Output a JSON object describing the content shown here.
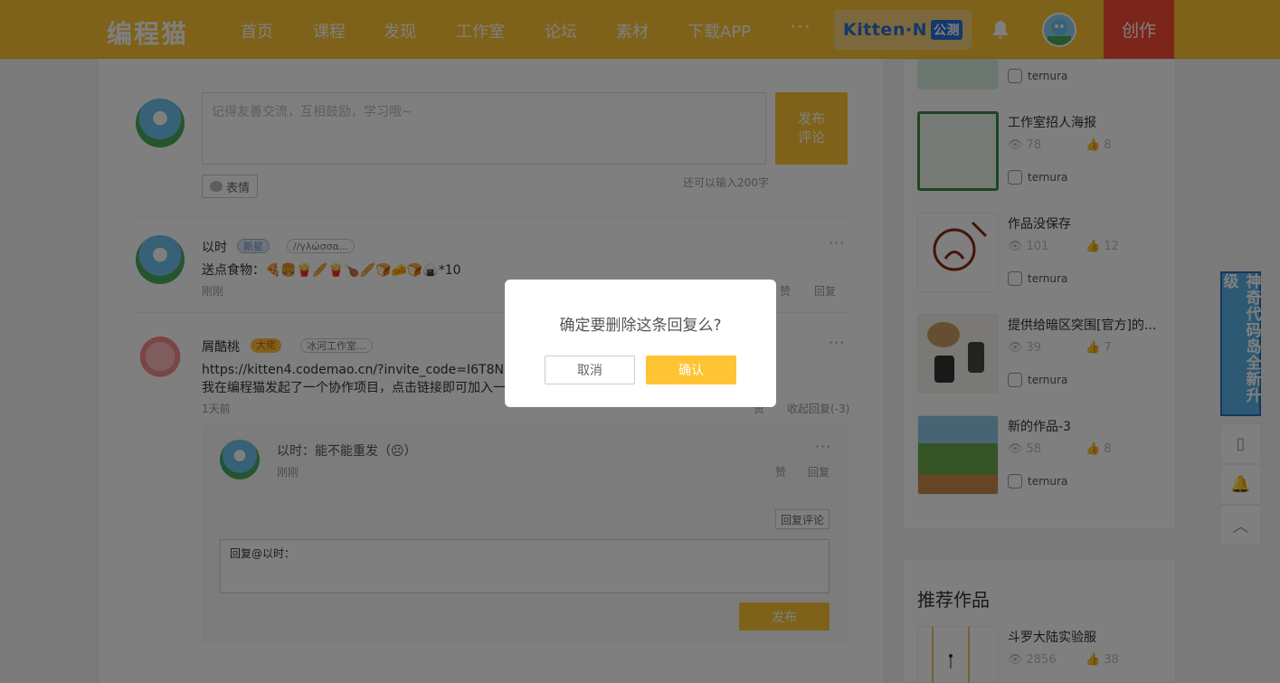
{
  "header": {
    "logo": "编程猫",
    "nav": [
      "首页",
      "课程",
      "发现",
      "工作室",
      "论坛",
      "素材",
      "下载APP"
    ],
    "more": "···",
    "kitten": "Kitten·N",
    "kitten_beta": "公测",
    "create": "创作"
  },
  "comment_form": {
    "placeholder": "记得友善交流，互相鼓励，学习哦~",
    "post_label_1": "发布",
    "post_label_2": "评论",
    "emoji_label": "表情",
    "char_left": "还可以输入200字"
  },
  "comments": [
    {
      "user": "以时",
      "tag1": "新星",
      "tag2": "//γλώσσα...",
      "text": "送点食物：🍕🍔🍟🥖🍟🍗🥖🍞🧀🍞🍙*10",
      "time": "刚刚",
      "like": "赞",
      "reply": "回复"
    },
    {
      "user": "屑酷桃",
      "tag1": "大佬",
      "tag2": "冰河工作室...",
      "text1": "https://kitten4.codemao.cn/?invite_code=I6T8NR   邀",
      "text2": "我在编程猫发起了一个协作项目，点击链接即可加入一",
      "time": "1天前",
      "like": "赞",
      "reply": "收起回复(-3)"
    }
  ],
  "sub_reply": {
    "text": "以时：能不能重发（☹）",
    "time": "刚刚",
    "like": "赞",
    "reply": "回复",
    "reply_comment_btn": "回复评论",
    "reply_box_value": "回复@以时：",
    "post_btn": "发布"
  },
  "works": [
    {
      "title": "工作室招人海报",
      "views": "78",
      "likes": "8",
      "author": "ternura"
    },
    {
      "title": "作品没保存",
      "views": "101",
      "likes": "12",
      "author": "ternura"
    },
    {
      "title": "提供给暗区突围[官方]的...",
      "views": "39",
      "likes": "7",
      "author": "ternura"
    },
    {
      "title": "新的作品-3",
      "views": "58",
      "likes": "8",
      "author": "ternura"
    }
  ],
  "top_author": "ternura",
  "recommend": {
    "title": "推荐作品",
    "item_title": "斗罗大陆实验服",
    "item_views": "2856",
    "item_likes": "38"
  },
  "side_banner": "神奇代码岛全新升级",
  "modal": {
    "message": "确定要删除这条回复么?",
    "cancel": "取消",
    "confirm": "确认"
  },
  "colors": {
    "brand": "#fec433",
    "create": "#f94a36",
    "kitten_blue": "#2a6fd6"
  }
}
